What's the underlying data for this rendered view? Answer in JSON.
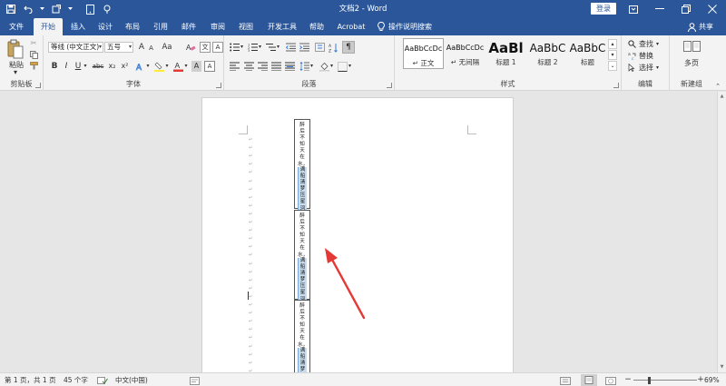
{
  "titlebar": {
    "title": "文档2 - Word",
    "login": "登录",
    "bg_color": "#2b579a"
  },
  "tabs": [
    {
      "label": "文件",
      "active": false
    },
    {
      "label": "开始",
      "active": true
    },
    {
      "label": "插入",
      "active": false
    },
    {
      "label": "设计",
      "active": false
    },
    {
      "label": "布局",
      "active": false
    },
    {
      "label": "引用",
      "active": false
    },
    {
      "label": "邮件",
      "active": false
    },
    {
      "label": "审阅",
      "active": false
    },
    {
      "label": "视图",
      "active": false
    },
    {
      "label": "开发工具",
      "active": false
    },
    {
      "label": "帮助",
      "active": false
    },
    {
      "label": "Acrobat",
      "active": false
    }
  ],
  "tell_me": "操作说明搜索",
  "share": "共享",
  "ribbon": {
    "clipboard": {
      "paste": "粘贴",
      "label": "剪贴板"
    },
    "font": {
      "font_name": "等线 (中文正文)",
      "font_size": "五号",
      "label": "字体",
      "grow": "A",
      "shrink": "A",
      "case": "Aa",
      "bold": "B",
      "italic": "I",
      "underline": "U",
      "strike": "abc",
      "subscript": "x₂",
      "superscript": "x²",
      "font_color_letter": "A",
      "highlight_letter": "A"
    },
    "paragraph": {
      "label": "段落"
    },
    "styles": {
      "label": "样式",
      "items": [
        {
          "preview": "AaBbCcDc",
          "name": "正文"
        },
        {
          "preview": "AaBbCcDc",
          "name": "无间隔"
        },
        {
          "preview": "AaBl",
          "name": "标题 1"
        },
        {
          "preview": "AaBbC",
          "name": "标题 2"
        },
        {
          "preview": "AaBbC",
          "name": "标题"
        }
      ]
    },
    "editing": {
      "find": "查找",
      "replace": "替换",
      "select": "选择",
      "label": "编辑"
    },
    "newgroup": {
      "multipage": "多页",
      "label": "新建组"
    }
  },
  "document": {
    "textbox_line1": "醉后不知天在水，",
    "textbox_line2": "满船清梦压星河",
    "textbox_count": 3,
    "paragraph_mark": "↵"
  },
  "annotation": {
    "arrow_color": "#e53935"
  },
  "statusbar": {
    "page": "第 1 页，共 1 页",
    "words": "45 个字",
    "language": "中文(中国)",
    "zoom": "69%",
    "zoom_minus": "−",
    "zoom_plus": "+"
  }
}
